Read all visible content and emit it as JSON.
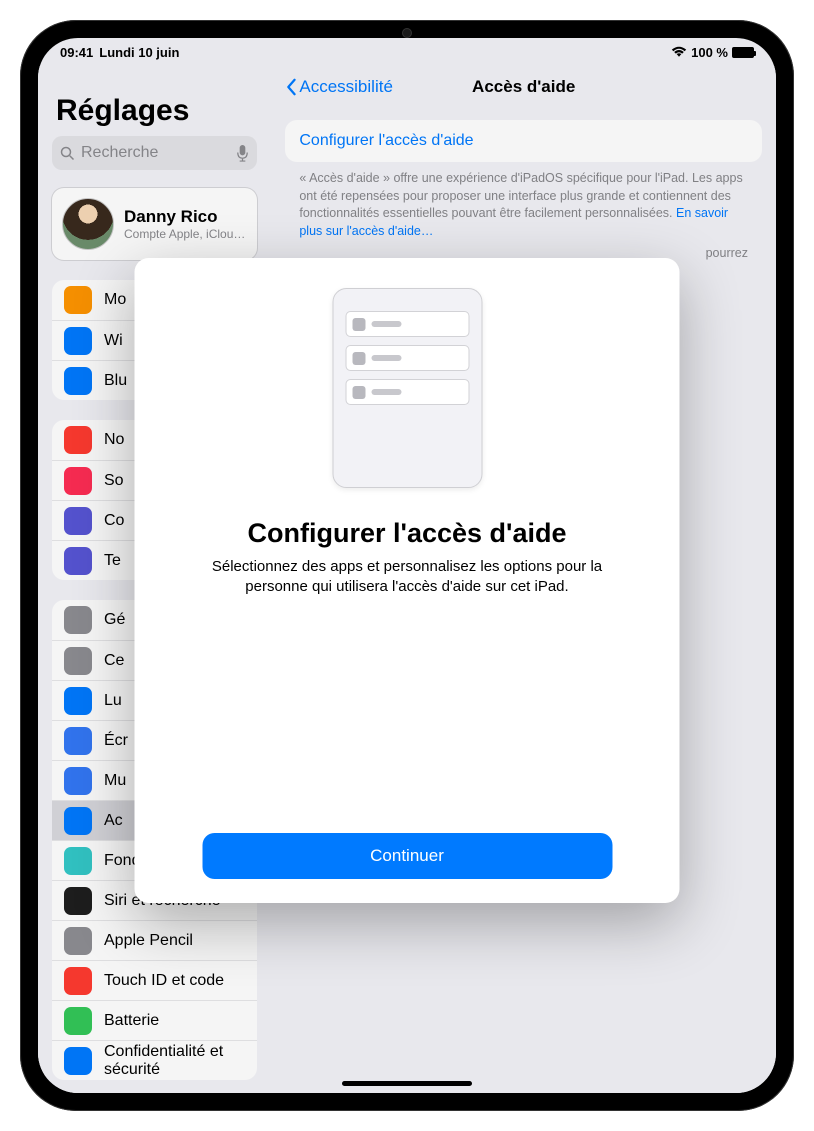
{
  "status": {
    "time": "09:41",
    "date": "Lundi 10 juin",
    "battery": "100 %"
  },
  "sidebar": {
    "title": "Réglages",
    "search_placeholder": "Recherche",
    "account": {
      "name": "Danny Rico",
      "sub": "Compte Apple, iCloud+, médias"
    },
    "g1": [
      {
        "label": "Mo",
        "color": "#ff9500"
      },
      {
        "label": "Wi",
        "color": "#007aff"
      },
      {
        "label": "Blu",
        "color": "#007aff"
      }
    ],
    "g2": [
      {
        "label": "No",
        "color": "#ff3b30"
      },
      {
        "label": "So",
        "color": "#ff2d55"
      },
      {
        "label": "Co",
        "color": "#5856d6"
      },
      {
        "label": "Te",
        "color": "#5856d6"
      }
    ],
    "g3": [
      {
        "label": "Gé",
        "color": "#8e8e93"
      },
      {
        "label": "Ce",
        "color": "#8e8e93"
      },
      {
        "label": "Lu",
        "color": "#007aff"
      },
      {
        "label": "Écr",
        "color": "#3478f6"
      },
      {
        "label": "Mu",
        "color": "#3478f6"
      },
      {
        "label": "Ac",
        "color": "#007aff",
        "selected": true
      },
      {
        "label": "Fond d'écran",
        "color": "#34c8c8"
      },
      {
        "label": "Siri et recherche",
        "color": "#1f1f1f"
      },
      {
        "label": "Apple Pencil",
        "color": "#8e8e93"
      },
      {
        "label": "Touch ID et code",
        "color": "#ff3b30"
      },
      {
        "label": "Batterie",
        "color": "#34c759"
      },
      {
        "label": "Confidentialité et sécurité",
        "color": "#007aff"
      }
    ]
  },
  "main": {
    "back": "Accessibilité",
    "title": "Accès d'aide",
    "link": "Configurer l'accès d'aide",
    "desc": "« Accès d'aide » offre une expérience d'iPadOS spécifique pour l'iPad. Les apps ont été repensées pour proposer une interface plus grande et contiennent des fonctionnalités essentielles pouvant être facilement personnalisées. ",
    "learn_more": "En savoir plus sur l'accès d'aide…",
    "desc_extra": "pourrez"
  },
  "modal": {
    "title": "Configurer l'accès d'aide",
    "body": "Sélectionnez des apps et personnalisez les options pour la personne qui utilisera l'accès d'aide sur cet iPad.",
    "button": "Continuer"
  }
}
